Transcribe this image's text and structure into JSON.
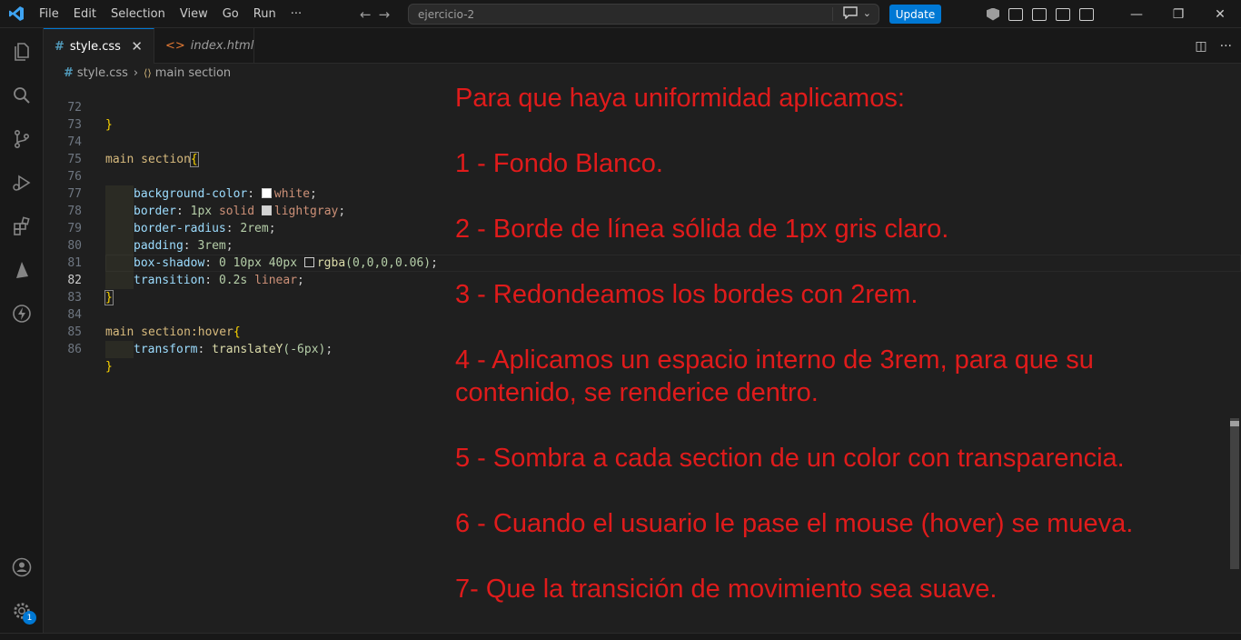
{
  "titlebar": {
    "menu": [
      "File",
      "Edit",
      "Selection",
      "View",
      "Go",
      "Run",
      "···"
    ],
    "search_text": "ejercicio-2",
    "update_label": "Update",
    "accent": "#0078d4"
  },
  "tabs": [
    {
      "label": "style.css",
      "active": true
    },
    {
      "label": "index.html",
      "active": false
    }
  ],
  "breadcrumb": {
    "file": "style.css",
    "symbol": "main section"
  },
  "editor": {
    "line_numbers": [
      "72",
      "73",
      "74",
      "75",
      "76",
      "77",
      "78",
      "79",
      "80",
      "81",
      "82",
      "83",
      "84",
      "85",
      "86"
    ],
    "current_line": "82",
    "lines": {
      "l72": "}",
      "l74_sel": "main section",
      "l76_prop": "background-color",
      "l76_val": "white",
      "l77_prop": "border",
      "l77_num": "1px",
      "l77_val1": "solid",
      "l77_val2": "lightgray",
      "l78_prop": "border-radius",
      "l78_num": "2rem",
      "l79_prop": "padding",
      "l79_num": "3rem",
      "l80_prop": "box-shadow",
      "l80_nums": "0 10px 40px",
      "l80_fn": "rgba",
      "l80_args": "(0,0,0,0.06)",
      "l81_prop": "transition",
      "l81_num": "0.2s",
      "l81_val": "linear",
      "l84_sel": "main section:hover",
      "l85_prop": "transform",
      "l85_fn": "translateY",
      "l85_args": "(-6px)"
    }
  },
  "notes": {
    "title": "Para que haya uniformidad aplicamos:",
    "items": [
      "1 - Fondo Blanco.",
      "2 - Borde de línea sólida de 1px gris claro.",
      "3 - Redondeamos los bordes con 2rem.",
      "4 - Aplicamos un espacio interno de 3rem, para que su\ncontenido, se renderice dentro.",
      "5 - Sombra a cada section de un color con transparencia.",
      "6 - Cuando el usuario le pase el mouse (hover) se mueva.",
      "7- Que la transición de movimiento sea suave."
    ],
    "color": "#e01b1b"
  },
  "activity": {
    "settings_badge": "1"
  }
}
